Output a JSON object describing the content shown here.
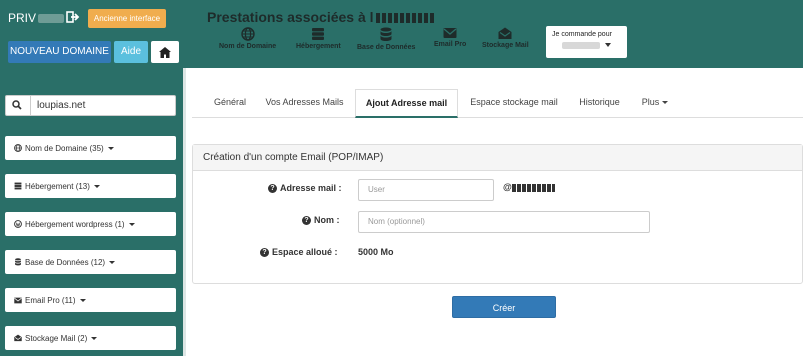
{
  "header": {
    "user_label": "PRIV",
    "old_interface_label": "Ancienne interface",
    "new_domain_label": "NOUVEAU DOMAINE",
    "help_label": "Aide",
    "title": "Prestations associées à l",
    "order_label": "Je commande pour"
  },
  "services": [
    {
      "label": "Nom de Domaine",
      "icon": "globe-icon"
    },
    {
      "label": "Hébergement",
      "icon": "server-icon"
    },
    {
      "label": "Base de Données",
      "icon": "database-icon"
    },
    {
      "label": "Email Pro",
      "icon": "envelope-icon"
    },
    {
      "label": "Stockage Mail",
      "icon": "inbox-icon"
    }
  ],
  "sidebar": {
    "search_value": "loupias.net",
    "items": [
      {
        "label": "Nom de Domaine (35)",
        "icon": "globe-icon"
      },
      {
        "label": "Hébergement (13)",
        "icon": "server-icon"
      },
      {
        "label": "Hébergement wordpress (1)",
        "icon": "wordpress-icon"
      },
      {
        "label": "Base de Données (12)",
        "icon": "database-icon"
      },
      {
        "label": "Email Pro (11)",
        "icon": "envelope-icon"
      },
      {
        "label": "Stockage Mail (2)",
        "icon": "inbox-icon"
      }
    ]
  },
  "tabs": [
    {
      "label": "Général"
    },
    {
      "label": "Vos Adresses Mails"
    },
    {
      "label": "Ajout Adresse mail"
    },
    {
      "label": "Espace stockage mail"
    },
    {
      "label": "Historique"
    },
    {
      "label": "Plus"
    }
  ],
  "form": {
    "panel_title": "Création d'un compte Email (POP/IMAP)",
    "email_label": "Adresse mail :",
    "email_placeholder": "User",
    "domain_prefix": "@",
    "name_label": "Nom :",
    "name_placeholder": "Nom (optionnel)",
    "quota_label": "Espace alloué :",
    "quota_value": "5000 Mo",
    "submit_label": "Créer"
  },
  "colors": {
    "header_bg": "#2a6f68",
    "primary": "#337ab7",
    "info": "#5bc0de",
    "warning": "#f0ad4e"
  }
}
